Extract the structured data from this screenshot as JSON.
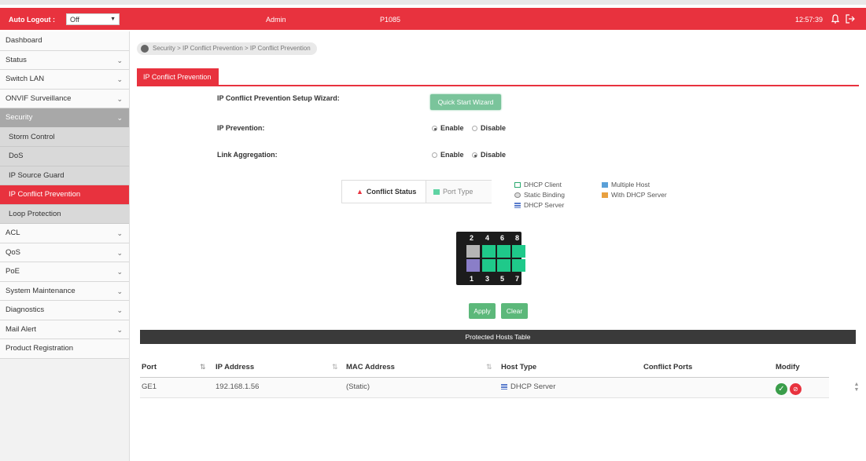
{
  "topbar": {
    "auto_logout_label": "Auto Logout :",
    "auto_logout_value": "Off",
    "user": "Admin",
    "model": "P1085",
    "time": "12:57:39"
  },
  "sidebar": {
    "items": [
      {
        "label": "Dashboard",
        "chevron": ""
      },
      {
        "label": "Status",
        "chevron": "⌄"
      },
      {
        "label": "Switch LAN",
        "chevron": "⌄"
      },
      {
        "label": "ONVIF Surveillance",
        "chevron": "⌄"
      },
      {
        "label": "Security",
        "chevron": "⌄"
      },
      {
        "label": "Storm Control",
        "chevron": ""
      },
      {
        "label": "DoS",
        "chevron": ""
      },
      {
        "label": "IP Source Guard",
        "chevron": ""
      },
      {
        "label": "IP Conflict Prevention",
        "chevron": ""
      },
      {
        "label": "Loop Protection",
        "chevron": ""
      },
      {
        "label": "ACL",
        "chevron": "⌄"
      },
      {
        "label": "QoS",
        "chevron": "⌄"
      },
      {
        "label": "PoE",
        "chevron": "⌄"
      },
      {
        "label": "System Maintenance",
        "chevron": "⌄"
      },
      {
        "label": "Diagnostics",
        "chevron": "⌄"
      },
      {
        "label": "Mail Alert",
        "chevron": "⌄"
      },
      {
        "label": "Product Registration",
        "chevron": ""
      }
    ]
  },
  "breadcrumb": "Security > IP Conflict Prevention > IP Conflict Prevention",
  "tab": "IP Conflict Prevention",
  "form": {
    "wizard_label": "IP Conflict Prevention Setup Wizard:",
    "wizard_button": "Quick Start Wizard",
    "prevention_label": "IP Prevention:",
    "link_agg_label": "Link Aggregation:",
    "enable": "Enable",
    "disable": "Disable",
    "prevention_value": "Enable",
    "link_agg_value": "Disable"
  },
  "legend": {
    "conflict_status": "Conflict Status",
    "port_type": "Port Type",
    "dhcp_client": "DHCP Client",
    "static_binding": "Static Binding",
    "dhcp_server": "DHCP Server",
    "multiple_host": "Multiple Host",
    "with_dhcp_server": "With DHCP Server"
  },
  "switch": {
    "top_numbers": [
      "2",
      "4",
      "6",
      "8"
    ],
    "bottom_numbers": [
      "1",
      "3",
      "5",
      "7"
    ]
  },
  "buttons": {
    "apply": "Apply",
    "clear": "Clear"
  },
  "table": {
    "title": "Protected Hosts Table",
    "headers": {
      "port": "Port",
      "ip": "IP Address",
      "mac": "MAC Address",
      "host_type": "Host Type",
      "conflict_ports": "Conflict Ports",
      "modify": "Modify"
    },
    "rows": [
      {
        "port": "GE1",
        "ip": "192.168.1.56",
        "mac": "(Static)",
        "host_type": "DHCP Server",
        "conflict_ports": ""
      }
    ]
  },
  "colors": {
    "brand_red": "#e8323e",
    "green": "#5cb87a",
    "port_green": "#1fc98a",
    "port_grey": "#b5b5b5",
    "port_purple": "#8a7ec8"
  }
}
